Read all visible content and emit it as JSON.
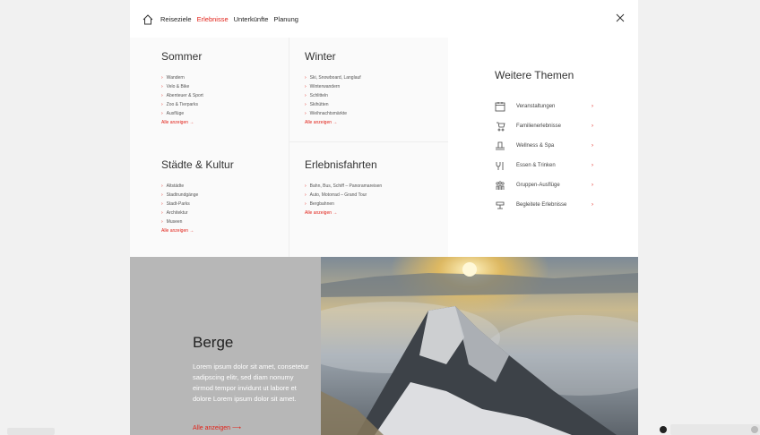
{
  "nav": {
    "links": [
      "Reiseziele",
      "Erlebnisse",
      "Unterkünfte",
      "Planung"
    ],
    "active_index": 1
  },
  "sections": [
    {
      "title": "Sommer",
      "items": [
        "Wandern",
        "Velo & Bike",
        "Abenteuer & Sport",
        "Zoo & Tierparks",
        "Ausflüge"
      ],
      "more": "Alle anzeigen →"
    },
    {
      "title": "Winter",
      "items": [
        "Ski, Snowboard, Langlauf",
        "Winterwandern",
        "Schlitteln",
        "Skihütten",
        "Weihnachtsmärkte"
      ],
      "more": "Alle anzeigen →"
    },
    {
      "title": "Städte & Kultur",
      "items": [
        "Altstädte",
        "Stadtrundgänge",
        "Stadt-Parks",
        "Architektur",
        "Museen"
      ],
      "more": "Alle anzeigen →"
    },
    {
      "title": "Erlebnisfahrten",
      "items": [
        "Bahn, Bus, Schiff – Panoramareisen",
        "Auto, Motorrad – Grand Tour",
        "Bergbahnen"
      ],
      "more": "Alle anzeigen →"
    }
  ],
  "themes": {
    "title": "Weitere Themen",
    "items": [
      {
        "label": "Veranstaltungen",
        "icon": "calendar-icon"
      },
      {
        "label": "Familienerlebnisse",
        "icon": "stroller-icon"
      },
      {
        "label": "Wellness & Spa",
        "icon": "spa-icon"
      },
      {
        "label": "Essen & Trinken",
        "icon": "dining-icon"
      },
      {
        "label": "Gruppen-Ausflüge",
        "icon": "group-icon"
      },
      {
        "label": "Begleitete Erlebnisse",
        "icon": "guide-icon"
      }
    ],
    "arrow": "›"
  },
  "hero": {
    "title": "Berge",
    "text": "Lorem ipsum dolor sit amet, consetetur sadipscing elitr, sed diam nonumy eirmod tempor invidunt ut labore et dolore Lorem ipsum dolor sit amet.",
    "cta": "Alle anzeigen  ⟶"
  },
  "colors": {
    "accent": "#e2231a"
  }
}
